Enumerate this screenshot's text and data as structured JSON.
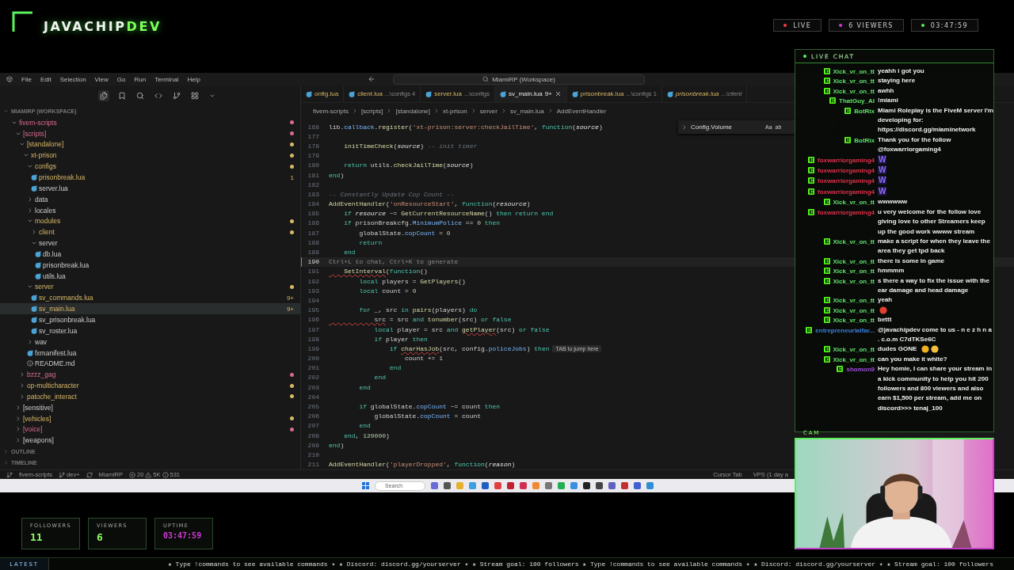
{
  "stream": {
    "logo": {
      "name": "JAVACHIP",
      "accent": "DEV"
    },
    "badges": [
      {
        "kind": "live",
        "label": "LIVE"
      },
      {
        "kind": "viewers",
        "label": "6 VIEWERS"
      },
      {
        "kind": "uptime",
        "label": "03:47:59"
      }
    ]
  },
  "ide": {
    "menu": [
      "File",
      "Edit",
      "Selection",
      "View",
      "Go",
      "Run",
      "Terminal",
      "Help"
    ],
    "search": "MiamiRP (Workspace)",
    "sidebar": {
      "title": "MIAMIRP (WORKSPACE)",
      "tree": [
        {
          "name": "fivem-scripts",
          "kind": "folder",
          "expanded": true,
          "selected": false,
          "untracked": true,
          "dot": true,
          "children": [
            {
              "name": "[scripts]",
              "kind": "folder",
              "expanded": true,
              "selected": false,
              "untracked": true,
              "dot": true,
              "children": [
                {
                  "name": "[standalone]",
                  "kind": "folder",
                  "expanded": true,
                  "selected": false,
                  "untracked": false,
                  "modified": true,
                  "dot": true,
                  "children": [
                    {
                      "name": "xt-prison",
                      "kind": "folder",
                      "expanded": true,
                      "selected": false,
                      "untracked": false,
                      "modified": true,
                      "dot": true,
                      "children": [
                        {
                          "name": "configs",
                          "kind": "folder",
                          "expanded": true,
                          "selected": false,
                          "untracked": false,
                          "modified": true,
                          "dot": true,
                          "children": [
                            {
                              "name": "prisonbreak.lua",
                              "kind": "lua",
                              "selected": false,
                              "untracked": false,
                              "modified": true,
                              "dot": false,
                              "badge": "1"
                            },
                            {
                              "name": "server.lua",
                              "kind": "lua",
                              "selected": false,
                              "untracked": false,
                              "modified": false,
                              "dot": false
                            }
                          ]
                        },
                        {
                          "name": "data",
                          "kind": "folder",
                          "expanded": false,
                          "selected": false,
                          "untracked": false,
                          "modified": false,
                          "dot": false
                        },
                        {
                          "name": "locales",
                          "kind": "folder",
                          "expanded": false,
                          "selected": false,
                          "untracked": false,
                          "modified": false,
                          "dot": false
                        },
                        {
                          "name": "modules",
                          "kind": "folder",
                          "expanded": true,
                          "selected": false,
                          "untracked": false,
                          "modified": true,
                          "dot": true,
                          "children": [
                            {
                              "name": "client",
                              "kind": "folder",
                              "expanded": false,
                              "selected": false,
                              "untracked": false,
                              "modified": true,
                              "dot": true
                            },
                            {
                              "name": "server",
                              "kind": "folder",
                              "expanded": true,
                              "selected": false,
                              "untracked": false,
                              "modified": false,
                              "dot": false,
                              "children": [
                                {
                                  "name": "db.lua",
                                  "kind": "lua",
                                  "selected": false,
                                  "untracked": false,
                                  "modified": false,
                                  "dot": false
                                },
                                {
                                  "name": "prisonbreak.lua",
                                  "kind": "lua",
                                  "selected": false,
                                  "untracked": false,
                                  "modified": false,
                                  "dot": false
                                },
                                {
                                  "name": "utils.lua",
                                  "kind": "lua",
                                  "selected": false,
                                  "untracked": false,
                                  "modified": false,
                                  "dot": false
                                }
                              ]
                            }
                          ]
                        },
                        {
                          "name": "server",
                          "kind": "folder",
                          "expanded": true,
                          "selected": false,
                          "untracked": false,
                          "modified": true,
                          "dot": true,
                          "children": [
                            {
                              "name": "sv_commands.lua",
                              "kind": "lua",
                              "selected": false,
                              "untracked": false,
                              "modified": true,
                              "dot": false,
                              "badge": "9+"
                            },
                            {
                              "name": "sv_main.lua",
                              "kind": "lua",
                              "selected": true,
                              "untracked": false,
                              "modified": true,
                              "dot": false,
                              "badge": "9+"
                            },
                            {
                              "name": "sv_prisonbreak.lua",
                              "kind": "lua",
                              "selected": false,
                              "untracked": false,
                              "modified": false,
                              "dot": false
                            },
                            {
                              "name": "sv_roster.lua",
                              "kind": "lua",
                              "selected": false,
                              "untracked": false,
                              "modified": false,
                              "dot": false
                            }
                          ]
                        },
                        {
                          "name": "wav",
                          "kind": "folder",
                          "expanded": false,
                          "selected": false,
                          "untracked": false,
                          "modified": false,
                          "dot": false
                        },
                        {
                          "name": "fxmanifest.lua",
                          "kind": "lua",
                          "selected": false,
                          "untracked": false,
                          "modified": false,
                          "dot": false
                        },
                        {
                          "name": "README.md",
                          "kind": "info",
                          "selected": false,
                          "untracked": false,
                          "modified": false,
                          "dot": false
                        }
                      ]
                    }
                  ]
                },
                {
                  "name": "bzzz_gag",
                  "kind": "folder",
                  "expanded": false,
                  "selected": false,
                  "untracked": true,
                  "dot": true
                },
                {
                  "name": "op-multicharacter",
                  "kind": "folder",
                  "expanded": false,
                  "selected": false,
                  "untracked": false,
                  "modified": true,
                  "dot": true
                },
                {
                  "name": "patoche_interact",
                  "kind": "folder",
                  "expanded": false,
                  "selected": false,
                  "untracked": false,
                  "modified": true,
                  "dot": true
                }
              ]
            },
            {
              "name": "[sensitive]",
              "kind": "folder",
              "expanded": false,
              "selected": false,
              "untracked": false,
              "modified": false,
              "dot": false
            },
            {
              "name": "[vehicles]",
              "kind": "folder",
              "expanded": false,
              "selected": false,
              "untracked": false,
              "modified": true,
              "dot": true
            },
            {
              "name": "[voice]",
              "kind": "folder",
              "expanded": false,
              "selected": false,
              "untracked": true,
              "dot": true
            },
            {
              "name": "[weapons]",
              "kind": "folder",
              "expanded": false,
              "selected": false,
              "untracked": false,
              "modified": false,
              "dot": false
            }
          ]
        }
      ],
      "sections": [
        "OUTLINE",
        "TIMELINE"
      ]
    },
    "tabs": [
      {
        "name": "onfig.lua",
        "selected": false,
        "preview": false
      },
      {
        "name": "client.lua",
        "path": "...\\configs 4",
        "selected": false,
        "preview": false
      },
      {
        "name": "server.lua",
        "path": "...\\configs",
        "selected": false,
        "preview": false
      },
      {
        "name": "sv_main.lua",
        "badge": "9+",
        "selected": true,
        "preview": false
      },
      {
        "name": "prisonbreak.lua",
        "path": "...\\configs 1",
        "selected": false,
        "preview": false
      },
      {
        "name": "prisonbreak.lua",
        "path": "...\\client",
        "selected": false,
        "preview": true
      }
    ],
    "breadcrumb": [
      "fivem-scripts",
      "[scripts]",
      "[standalone]",
      "xt-prison",
      "server",
      "sv_main.lua",
      "AddEventHandler"
    ],
    "find": {
      "value": "Config.Volume",
      "options": [
        "Aa",
        "ab"
      ]
    },
    "lines": [
      {
        "n": "168",
        "segs": [
          {
            "kind": "plain",
            "t": "lib."
          },
          {
            "kind": "member",
            "t": "callback"
          },
          {
            "kind": "plain",
            "t": "."
          },
          {
            "kind": "func",
            "t": "register"
          },
          {
            "kind": "plain",
            "t": "("
          },
          {
            "kind": "string",
            "t": "'xt-prison:server:checkJailTime'"
          },
          {
            "kind": "plain",
            "t": ", "
          },
          {
            "kind": "keyword",
            "t": "function"
          },
          {
            "kind": "plain",
            "t": "("
          },
          {
            "kind": "param",
            "t": "source"
          },
          {
            "kind": "plain",
            "t": ")"
          }
        ]
      },
      {
        "n": "177"
      },
      {
        "n": "178",
        "segs": [
          {
            "kind": "func",
            "t": "    initTimeCheck"
          },
          {
            "kind": "plain",
            "t": "("
          },
          {
            "kind": "param",
            "t": "source"
          },
          {
            "kind": "plain",
            "t": ") "
          },
          {
            "kind": "comment",
            "t": "-- init timer"
          }
        ]
      },
      {
        "n": "179"
      },
      {
        "n": "180",
        "segs": [
          {
            "kind": "keyword",
            "t": "    return "
          },
          {
            "kind": "plain",
            "t": "utils."
          },
          {
            "kind": "func",
            "t": "checkJailTime"
          },
          {
            "kind": "plain",
            "t": "("
          },
          {
            "kind": "param",
            "t": "source"
          },
          {
            "kind": "plain",
            "t": ")"
          }
        ]
      },
      {
        "n": "181",
        "segs": [
          {
            "kind": "keyword",
            "t": "end"
          },
          {
            "kind": "plain",
            "t": ")"
          }
        ]
      },
      {
        "n": "182"
      },
      {
        "n": "183",
        "segs": [
          {
            "kind": "comment",
            "t": "-- Constantly Update Cop Count --"
          }
        ]
      },
      {
        "n": "184",
        "segs": [
          {
            "kind": "func",
            "t": "AddEventHandler"
          },
          {
            "kind": "plain",
            "t": "("
          },
          {
            "kind": "string",
            "t": "'onResourceStart'"
          },
          {
            "kind": "plain",
            "t": ", "
          },
          {
            "kind": "keyword",
            "t": "function"
          },
          {
            "kind": "plain",
            "t": "("
          },
          {
            "kind": "param",
            "t": "resource"
          },
          {
            "kind": "plain",
            "t": ")"
          }
        ]
      },
      {
        "n": "185",
        "segs": [
          {
            "kind": "keyword",
            "t": "    if "
          },
          {
            "kind": "param",
            "t": "resource"
          },
          {
            "kind": "plain",
            "t": " ~= "
          },
          {
            "kind": "func",
            "t": "GetCurrentResourceName"
          },
          {
            "kind": "plain",
            "t": "() "
          },
          {
            "kind": "keyword",
            "t": "then return end"
          }
        ]
      },
      {
        "n": "186",
        "segs": [
          {
            "kind": "keyword",
            "t": "    if "
          },
          {
            "kind": "plain",
            "t": "prisonBreakcfg."
          },
          {
            "kind": "member",
            "t": "MinimumPolice"
          },
          {
            "kind": "plain",
            "t": " == "
          },
          {
            "kind": "number",
            "t": "0"
          },
          {
            "kind": "keyword",
            "t": " then"
          }
        ]
      },
      {
        "n": "187",
        "segs": [
          {
            "kind": "plain",
            "t": "        globalState."
          },
          {
            "kind": "member",
            "t": "copCount"
          },
          {
            "kind": "plain",
            "t": " = "
          },
          {
            "kind": "number",
            "t": "0"
          }
        ]
      },
      {
        "n": "188",
        "segs": [
          {
            "kind": "keyword",
            "t": "        return"
          }
        ]
      },
      {
        "n": "189",
        "segs": [
          {
            "kind": "keyword",
            "t": "    end"
          }
        ]
      },
      {
        "n": "190",
        "ghost": "Ctrl+L to chat, Ctrl+K to generate"
      },
      {
        "n": "191",
        "segs": [
          {
            "kind": "func_warn",
            "t": "    SetInterval"
          },
          {
            "kind": "plain",
            "t": "("
          },
          {
            "kind": "keyword",
            "t": "function"
          },
          {
            "kind": "plain",
            "t": "()"
          }
        ]
      },
      {
        "n": "192",
        "segs": [
          {
            "kind": "keyword",
            "t": "        local "
          },
          {
            "kind": "plain",
            "t": "players = "
          },
          {
            "kind": "func",
            "t": "GetPlayers"
          },
          {
            "kind": "plain",
            "t": "()"
          }
        ]
      },
      {
        "n": "193",
        "segs": [
          {
            "kind": "keyword",
            "t": "        local "
          },
          {
            "kind": "plain",
            "t": "count = "
          },
          {
            "kind": "number",
            "t": "0"
          }
        ]
      },
      {
        "n": "194"
      },
      {
        "n": "195",
        "segs": [
          {
            "kind": "keyword",
            "t": "        for "
          },
          {
            "kind": "plain",
            "t": "_, src "
          },
          {
            "kind": "keyword",
            "t": "in "
          },
          {
            "kind": "func",
            "t": "pairs"
          },
          {
            "kind": "plain",
            "t": "(players) "
          },
          {
            "kind": "keyword",
            "t": "do"
          }
        ]
      },
      {
        "n": "196",
        "segs": [
          {
            "kind": "plain_warn",
            "t": "            src"
          },
          {
            "kind": "plain",
            "t": " = src "
          },
          {
            "kind": "keyword",
            "t": "and "
          },
          {
            "kind": "func",
            "t": "tonumber"
          },
          {
            "kind": "plain",
            "t": "(src) "
          },
          {
            "kind": "keyword",
            "t": "or false"
          }
        ]
      },
      {
        "n": "197",
        "segs": [
          {
            "kind": "keyword",
            "t": "            local "
          },
          {
            "kind": "plain",
            "t": "player = src "
          },
          {
            "kind": "keyword",
            "t": "and "
          },
          {
            "kind": "func_warn",
            "t": "getPlayer"
          },
          {
            "kind": "plain",
            "t": "(src) "
          },
          {
            "kind": "keyword",
            "t": "or false"
          }
        ]
      },
      {
        "n": "198",
        "segs": [
          {
            "kind": "keyword",
            "t": "            if "
          },
          {
            "kind": "plain",
            "t": "player "
          },
          {
            "kind": "keyword",
            "t": "then"
          }
        ]
      },
      {
        "n": "199",
        "segs": [
          {
            "kind": "keyword",
            "t": "                if "
          },
          {
            "kind": "func_warn",
            "t": "charHasJob"
          },
          {
            "kind": "plain",
            "t": "(src, config."
          },
          {
            "kind": "member",
            "t": "policeJobs"
          },
          {
            "kind": "plain",
            "t": ") "
          },
          {
            "kind": "keyword",
            "t": "then"
          }
        ],
        "tip": "TAB to jump here"
      },
      {
        "n": "200",
        "segs": [
          {
            "kind": "plain",
            "t": "                    count += "
          },
          {
            "kind": "number",
            "t": "1"
          }
        ]
      },
      {
        "n": "201",
        "segs": [
          {
            "kind": "keyword",
            "t": "                end"
          }
        ]
      },
      {
        "n": "202",
        "segs": [
          {
            "kind": "keyword",
            "t": "            end"
          }
        ]
      },
      {
        "n": "203",
        "segs": [
          {
            "kind": "keyword",
            "t": "        end"
          }
        ]
      },
      {
        "n": "204"
      },
      {
        "n": "205",
        "segs": [
          {
            "kind": "keyword",
            "t": "        if "
          },
          {
            "kind": "plain",
            "t": "globalState."
          },
          {
            "kind": "member",
            "t": "copCount"
          },
          {
            "kind": "plain",
            "t": " ~= count "
          },
          {
            "kind": "keyword",
            "t": "then"
          }
        ]
      },
      {
        "n": "206",
        "segs": [
          {
            "kind": "plain",
            "t": "            globalState."
          },
          {
            "kind": "member",
            "t": "copCount"
          },
          {
            "kind": "plain",
            "t": " = count"
          }
        ]
      },
      {
        "n": "207",
        "segs": [
          {
            "kind": "keyword",
            "t": "        end"
          }
        ]
      },
      {
        "n": "208",
        "segs": [
          {
            "kind": "keyword",
            "t": "    end"
          },
          {
            "kind": "plain",
            "t": ", "
          },
          {
            "kind": "number",
            "t": "120000"
          },
          {
            "kind": "plain",
            "t": ")"
          }
        ]
      },
      {
        "n": "209",
        "segs": [
          {
            "kind": "keyword",
            "t": "end"
          },
          {
            "kind": "plain",
            "t": ")"
          }
        ]
      },
      {
        "n": "210"
      },
      {
        "n": "211",
        "segs": [
          {
            "kind": "func",
            "t": "AddEventHandler"
          },
          {
            "kind": "plain",
            "t": "("
          },
          {
            "kind": "string",
            "t": "'playerDropped'"
          },
          {
            "kind": "plain",
            "t": ", "
          },
          {
            "kind": "keyword",
            "t": "function"
          },
          {
            "kind": "plain",
            "t": "("
          },
          {
            "kind": "param",
            "t": "reason"
          },
          {
            "kind": "plain",
            "t": ")"
          }
        ]
      }
    ],
    "status": {
      "folder": "fivem-scripts",
      "branch": "dev+",
      "workspace": "MiamiRP",
      "errors": "20",
      "warnings": "5K",
      "infos": "531",
      "right": [
        "Cursor Tab",
        "VPS (1 day a"
      ]
    }
  },
  "taskbar": {
    "search": "Search"
  },
  "chat": {
    "title": "LIVE CHAT",
    "messages": [
      {
        "user": "Xick_vr_on_tt",
        "color": "#5fe36a",
        "kind": "text",
        "text": "yeahh i got you"
      },
      {
        "user": "Xick_vr_on_tt",
        "color": "#5fe36a",
        "kind": "text",
        "text": "staying here"
      },
      {
        "user": "Xick_vr_on_tt",
        "color": "#5fe36a",
        "kind": "text",
        "text": "awhh"
      },
      {
        "user": "ThatGuy_AI",
        "color": "#5fe36a",
        "kind": "text",
        "text": "!miami"
      },
      {
        "user": "BotRix",
        "color": "#5fe36a",
        "kind": "text",
        "text": "Miami Roleplay is the FiveM server I'm developing for: https://discord.gg/miaminetwork"
      },
      {
        "user": "BotRix",
        "color": "#5fe36a",
        "kind": "text",
        "text": "Thank you for the follow @foxwarriorgaming4"
      },
      {
        "user": "foxwarriorgaming4",
        "color": "#e0304a",
        "kind": "emote",
        "text": "W"
      },
      {
        "user": "foxwarriorgaming4",
        "color": "#e0304a",
        "kind": "emote",
        "text": "W"
      },
      {
        "user": "foxwarriorgaming4",
        "color": "#e0304a",
        "kind": "emote",
        "text": "W"
      },
      {
        "user": "foxwarriorgaming4",
        "color": "#e0304a",
        "kind": "emote",
        "text": "W"
      },
      {
        "user": "Xick_vr_on_tt",
        "color": "#5fe36a",
        "kind": "text",
        "text": "wwwwww"
      },
      {
        "user": "foxwarriorgaming4",
        "color": "#e0304a",
        "kind": "text",
        "text": "u very welcome for the follow love giving love to other Streamers keep up the good work wwww stream"
      },
      {
        "user": "Xick_vr_on_tt",
        "color": "#5fe36a",
        "kind": "text",
        "text": "make a script for when they leave the area they get tpd back"
      },
      {
        "user": "Xick_vr_on_tt",
        "color": "#5fe36a",
        "kind": "text",
        "text": "there is some in game"
      },
      {
        "user": "Xick_vr_on_tt",
        "color": "#5fe36a",
        "kind": "text",
        "text": "hmmmm"
      },
      {
        "user": "Xick_vr_on_tt",
        "color": "#5fe36a",
        "kind": "text",
        "text": "s there a way to fix the issue with the ear damage and head damage"
      },
      {
        "user": "Xick_vr_on_tt",
        "color": "#5fe36a",
        "kind": "text",
        "text": "yeah"
      },
      {
        "user": "Xick_vr_on_tt",
        "color": "#5fe36a",
        "kind": "icon"
      },
      {
        "user": "Xick_vr_on_tt",
        "color": "#5fe36a",
        "kind": "text",
        "text": "bettt"
      },
      {
        "user": "entrepreneurialfar...",
        "color": "#3b7fd9",
        "kind": "text",
        "text": "@javachipdev come to us - n e z h n a . c.o.m C7dTKSe6C"
      },
      {
        "user": "Xick_vr_on_tt",
        "color": "#5fe36a",
        "kind": "text_emoji",
        "text": "dudes GONE"
      },
      {
        "user": "Xick_vr_on_tt",
        "color": "#5fe36a",
        "kind": "text",
        "text": "can you make it white?"
      },
      {
        "user": "shomon9",
        "color": "#a14de0",
        "kind": "text",
        "text": "Hey homie, I can share your stream in a kick community to help you hit 200 followers and 800 viewers and also earn $1,500 per stream, add me on discord>>> tenaj_100"
      }
    ]
  },
  "cam": {
    "label": "CAM"
  },
  "stats": [
    {
      "label": "FOLLOWERS",
      "value": "11",
      "kind": "count"
    },
    {
      "label": "VIEWERS",
      "value": "6",
      "kind": "count"
    },
    {
      "label": "UPTIME",
      "value": "03:47:59",
      "kind": "time"
    }
  ],
  "ticker": {
    "label": "LATEST",
    "text": "★ Type !commands to see available commands ✦ ★ Discord: discord.gg/yourserver ✦ ★ Stream goal: 100 followers ★ Type !commands to see available commands ✦ ★ Discord: discord.gg/yourserver ✦ ★ Stream goal: 100 followers"
  }
}
